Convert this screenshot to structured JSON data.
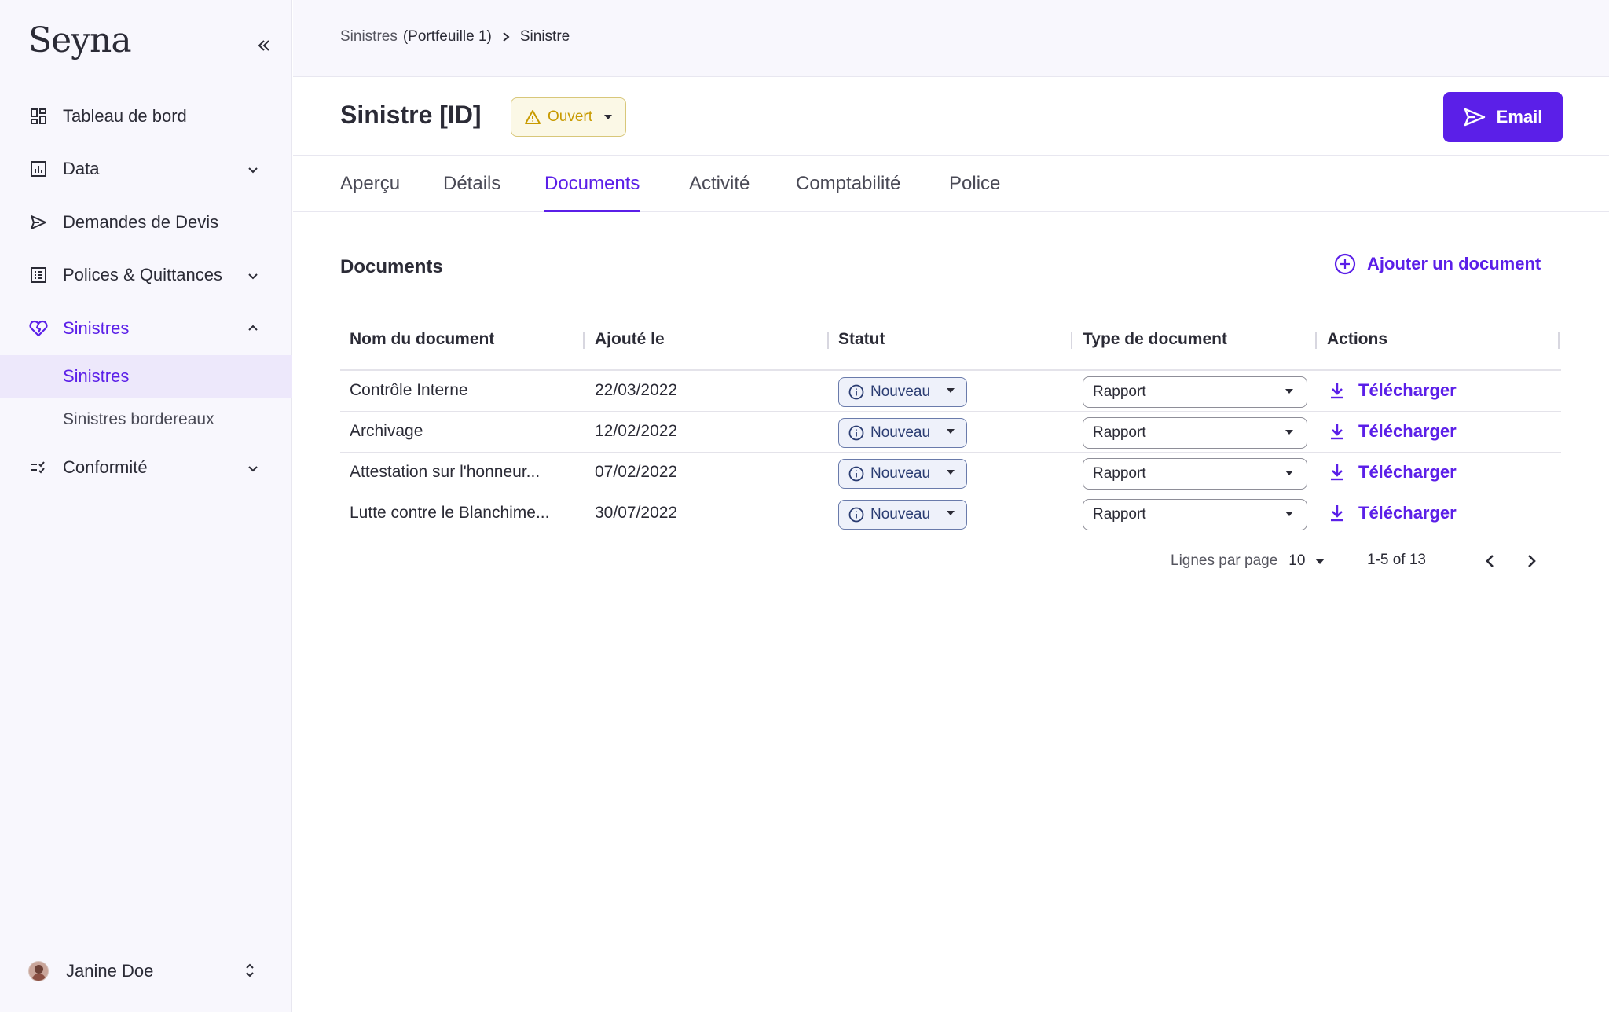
{
  "brand": {
    "name": "Seyna",
    "accent": "#5b1fe8"
  },
  "sidebar": {
    "collapse_icon": "double-chevron-left-icon",
    "items": [
      {
        "label": "Tableau de bord",
        "icon": "dashboard-icon"
      },
      {
        "label": "Data",
        "icon": "chart-icon"
      },
      {
        "label": "Demandes de Devis",
        "icon": "send-icon"
      },
      {
        "label": "Polices & Quittances",
        "icon": "list-icon"
      },
      {
        "label": "Sinistres",
        "icon": "heart-broken-icon"
      },
      {
        "label": "Conformité",
        "icon": "checklist-icon"
      }
    ],
    "sub_items": [
      {
        "label": "Sinistres"
      },
      {
        "label": "Sinistres bordereaux"
      }
    ],
    "user": {
      "name": "Janine Doe"
    }
  },
  "breadcrumb": {
    "part1": "Sinistres",
    "part2": "(Portfeuille 1)",
    "current": "Sinistre"
  },
  "header": {
    "title": "Sinistre [ID]",
    "status": "Ouvert",
    "email_label": "Email"
  },
  "tabs": [
    {
      "label": "Aperçu"
    },
    {
      "label": "Détails"
    },
    {
      "label": "Documents"
    },
    {
      "label": "Activité"
    },
    {
      "label": "Comptabilité"
    },
    {
      "label": "Police"
    }
  ],
  "documents": {
    "title": "Documents",
    "add_label": "Ajouter un document",
    "columns": [
      "Nom du document",
      "Ajouté le",
      "Statut",
      "Type de document",
      "Actions"
    ],
    "rows": [
      {
        "name": "Contrôle Interne",
        "date": "22/03/2022",
        "status": "Nouveau",
        "type": "Rapport",
        "action": "Télécharger"
      },
      {
        "name": "Archivage",
        "date": "12/02/2022",
        "status": "Nouveau",
        "type": "Rapport",
        "action": "Télécharger"
      },
      {
        "name": "Attestation sur l'honneur...",
        "date": "07/02/2022",
        "status": "Nouveau",
        "type": "Rapport",
        "action": "Télécharger"
      },
      {
        "name": "Lutte contre le Blanchime...",
        "date": "30/07/2022",
        "status": "Nouveau",
        "type": "Rapport",
        "action": "Télécharger"
      }
    ]
  },
  "pagination": {
    "rows_label": "Lignes par page",
    "rows_value": "10",
    "range": "1-5 of 13"
  }
}
